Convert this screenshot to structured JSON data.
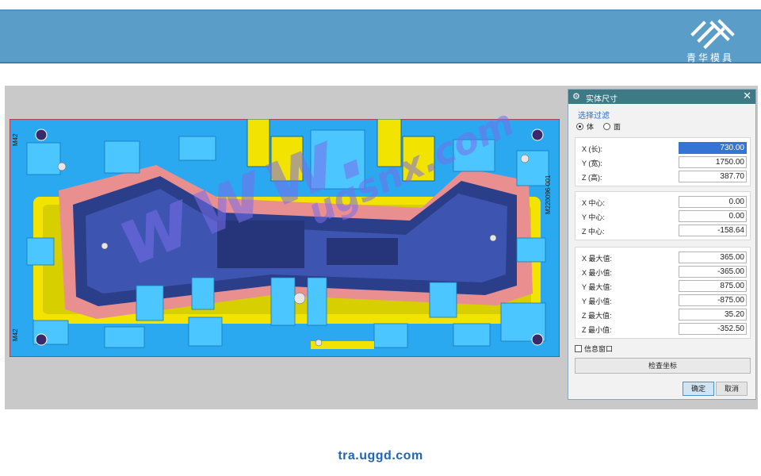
{
  "header": {
    "logo_text": "青华模具"
  },
  "viewport": {
    "labels": {
      "top_left": "M42",
      "bottom_left": "M42",
      "right_side": "M220096-001"
    }
  },
  "dialog": {
    "title": "实体尺寸",
    "filter_label": "选择过滤",
    "radio_solid": "体",
    "radio_face": "面",
    "size": [
      {
        "label": "X (长):",
        "value": "730.00",
        "selected": true
      },
      {
        "label": "Y (宽):",
        "value": "1750.00"
      },
      {
        "label": "Z (高):",
        "value": "387.70"
      }
    ],
    "center": [
      {
        "label": "X 中心:",
        "value": "0.00"
      },
      {
        "label": "Y 中心:",
        "value": "0.00"
      },
      {
        "label": "Z 中心:",
        "value": "-158.64"
      }
    ],
    "extents": [
      {
        "label": "X 最大值:",
        "value": "365.00"
      },
      {
        "label": "X 最小值:",
        "value": "-365.00"
      },
      {
        "label": "Y 最大值:",
        "value": "875.00"
      },
      {
        "label": "Y 最小值:",
        "value": "-875.00"
      },
      {
        "label": "Z 最大值:",
        "value": "35.20"
      },
      {
        "label": "Z 最小值:",
        "value": "-352.50"
      }
    ],
    "info_window": "信息窗口",
    "check_coords": "检查坐标",
    "ok": "确定",
    "cancel": "取消"
  },
  "footer": {
    "url": "tra.uggd.com"
  },
  "colors": {
    "header": "#5a9dc9",
    "dialog_title": "#3d7a86",
    "mold_blue": "#2aa8f0",
    "mold_yellow": "#f2e400",
    "mold_pink": "#e98f8f",
    "mold_navy": "#2b3e8a"
  }
}
